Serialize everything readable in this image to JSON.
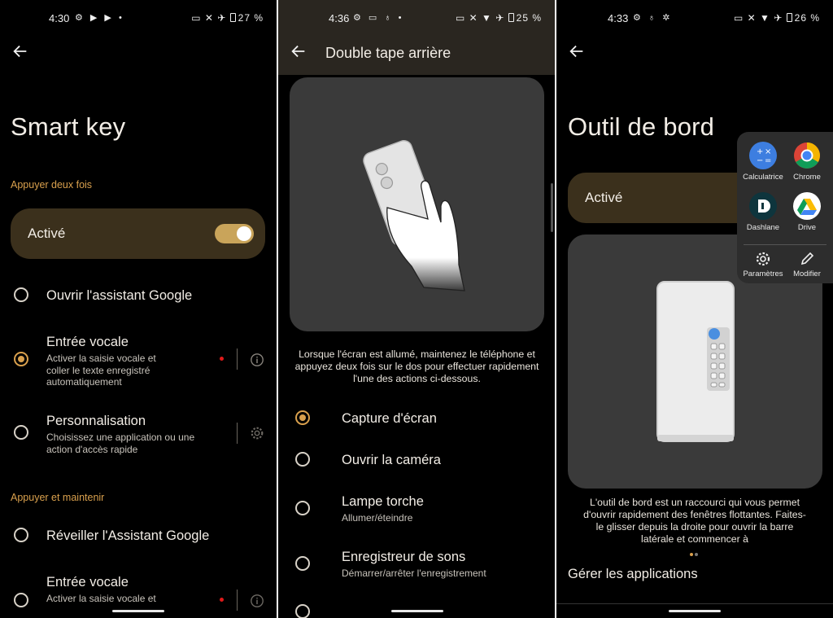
{
  "colors": {
    "accent": "#d9a04d",
    "card": "#3b301c",
    "switch_on": "#c9a45a",
    "illustration_bg": "#3a3a3a"
  },
  "panel1": {
    "status": {
      "time": "4:30",
      "battery": "27 %"
    },
    "title": "Smart key",
    "section_double_press": "Appuyer deux fois",
    "activated_label": "Activé",
    "activated_on": true,
    "options": [
      {
        "title": "Ouvrir l'assistant Google",
        "subtitle": ""
      },
      {
        "title": "Entrée vocale",
        "subtitle": "Activer la saisie vocale et coller le texte enregistré automatiquement"
      },
      {
        "title": "Personnalisation",
        "subtitle": "Choisissez une application ou une action d'accès rapide"
      }
    ],
    "selected_option": 1,
    "section_press_hold": "Appuyer et maintenir",
    "options_hold": [
      {
        "title": "Réveiller l'Assistant Google",
        "subtitle": ""
      },
      {
        "title": "Entrée vocale",
        "subtitle": "Activer la saisie vocale et"
      }
    ]
  },
  "panel2": {
    "status": {
      "time": "4:36",
      "battery": "25 %"
    },
    "title": "Double tape arrière",
    "description": "Lorsque l'écran est allumé, maintenez le téléphone et appuyez deux fois sur le dos pour effectuer rapidement l'une des actions ci-dessous.",
    "options": [
      {
        "title": "Capture d'écran",
        "subtitle": ""
      },
      {
        "title": "Ouvrir la caméra",
        "subtitle": ""
      },
      {
        "title": "Lampe torche",
        "subtitle": "Allumer/éteindre"
      },
      {
        "title": "Enregistreur de sons",
        "subtitle": "Démarrer/arrêter l'enregistrement"
      }
    ],
    "selected_option": 0
  },
  "panel3": {
    "status": {
      "time": "4:33",
      "battery": "26 %"
    },
    "title": "Outil de bord",
    "activated_label": "Activé",
    "edge_apps": [
      {
        "label": "Calculatrice",
        "icon": "calculator-icon",
        "color": "#3d7ee0"
      },
      {
        "label": "Chrome",
        "icon": "chrome-icon",
        "color": "#ffffff"
      },
      {
        "label": "Dashlane",
        "icon": "dashlane-icon",
        "color": "#0e353d"
      },
      {
        "label": "Drive",
        "icon": "drive-icon",
        "color": "#ffffff"
      }
    ],
    "edge_actions": [
      {
        "label": "Paramètres",
        "icon": "gear-icon"
      },
      {
        "label": "Modifier",
        "icon": "pencil-icon"
      }
    ],
    "description": "L'outil de bord est un raccourci qui vous permet d'ouvrir rapidement des fenêtres flottantes. Faites-le glisser depuis la droite pour ouvrir la barre latérale et commencer à",
    "manage_label": "Gérer les applications"
  }
}
